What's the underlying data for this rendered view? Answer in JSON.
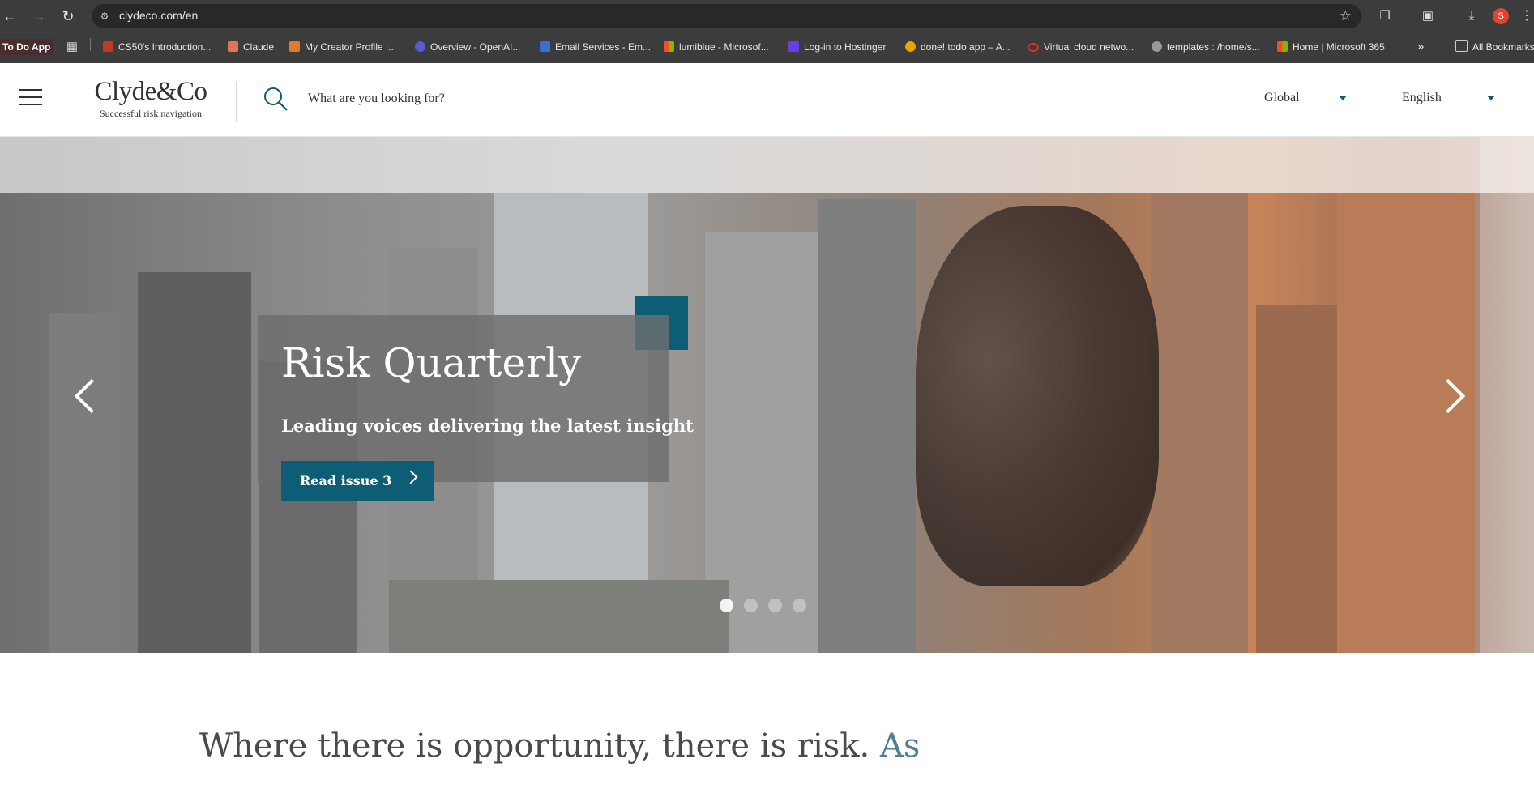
{
  "browser": {
    "url": "clydeco.com/en",
    "profile_initial": "S",
    "bookmarks": [
      {
        "label": "To Do App"
      },
      {
        "label": "CS50's Introduction...",
        "color": "#c0392b"
      },
      {
        "label": "Claude",
        "color": "#d97757"
      },
      {
        "label": "My Creator Profile |...",
        "color": "#e07a2f"
      },
      {
        "label": "Overview - OpenAI...",
        "color": "#5b5bd6"
      },
      {
        "label": "Email Services - Em...",
        "color": "#3b6fd6"
      },
      {
        "label": "lumiblue - Microsof...",
        "color": "#f25022"
      },
      {
        "label": "Log-in to Hostinger",
        "color": "#673de6"
      },
      {
        "label": "done! todo app – A...",
        "color": "#e8a20c"
      },
      {
        "label": "Virtual cloud netwo...",
        "color": "#d9342b"
      },
      {
        "label": "templates : /home/s...",
        "color": "#999999"
      },
      {
        "label": "Home | Microsoft 365",
        "color": "#f25022"
      }
    ],
    "more_bookmarks": "»",
    "all_bookmarks": "All Bookmarks"
  },
  "header": {
    "brand": "Clyde&Co",
    "tagline": "Successful risk navigation",
    "search_placeholder": "What are you looking for?",
    "region": "Global",
    "language": "English",
    "accent_color": "#0d5e74"
  },
  "hero": {
    "title": "Risk Quarterly",
    "subtitle": "Leading voices delivering the latest insight",
    "cta": "Read issue 3",
    "slide_count": 4,
    "active_slide": 1
  },
  "intro": {
    "text": "Where there is opportunity, there is risk.",
    "accent_text": "As"
  }
}
